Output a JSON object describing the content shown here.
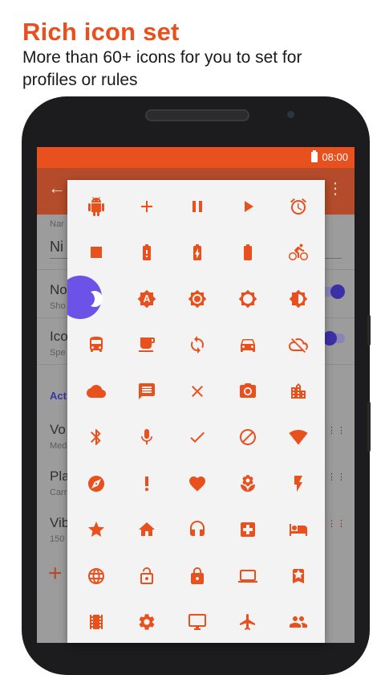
{
  "promo": {
    "headline": "Rich icon set",
    "subheadline": "More than 60+ icons for you to set for profiles or rules"
  },
  "status_bar": {
    "time": "08:00"
  },
  "background_app": {
    "name_label": "Nar",
    "name_value": "Ni",
    "item1_title": "No",
    "item1_sub": "Sho",
    "item2_title": "Ico",
    "item2_sub": "Spe",
    "section_label": "Act",
    "row1_title": "Vo",
    "row1_sub": "Med",
    "row2_title": "Pla",
    "row2_sub": "Carr",
    "row3_title": "Vib",
    "row3_sub": "150"
  },
  "icon_picker": {
    "accent_color": "#e8501d",
    "selected_color": "#6d52e8",
    "selected_index": 10,
    "icons": [
      "android",
      "add",
      "pause",
      "play",
      "alarm",
      "stop",
      "battery-alert",
      "battery-charging",
      "battery-full",
      "bike",
      "moon",
      "brightness-auto",
      "brightness-low",
      "brightness-high",
      "brightness-medium",
      "bus",
      "cafe",
      "sync",
      "car",
      "cloud-off",
      "cloud",
      "message",
      "close",
      "camera",
      "city",
      "bluetooth",
      "mic",
      "check",
      "block",
      "wifi",
      "compass",
      "exclamation",
      "heart",
      "flower",
      "flash",
      "star",
      "home",
      "headset",
      "hospital",
      "hotel",
      "globe",
      "lock-open",
      "lock",
      "laptop",
      "bookmark-star",
      "movie",
      "settings",
      "desktop",
      "airplane",
      "group"
    ]
  }
}
